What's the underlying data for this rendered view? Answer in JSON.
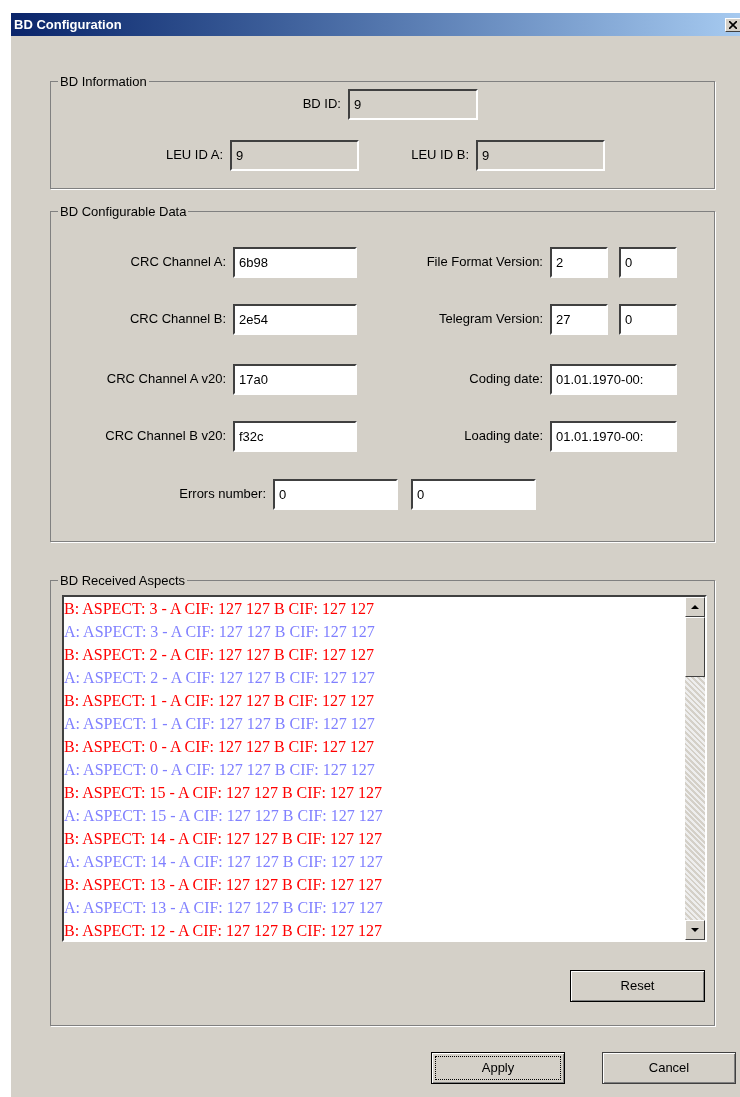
{
  "window": {
    "title": "BD Configuration"
  },
  "bd_information": {
    "title": "BD Information",
    "fields": [
      {
        "label": "BD ID:",
        "value": "9",
        "disabled": true
      },
      {
        "label": "LEU ID A:",
        "value": "9",
        "disabled": true
      },
      {
        "label": "LEU ID B:",
        "value": "9",
        "disabled": true
      }
    ]
  },
  "bd_configurable_data": {
    "title": "BD Configurable Data",
    "left_fields": [
      {
        "label": "CRC Channel A:",
        "value": "6b98",
        "disabled": false
      },
      {
        "label": "CRC Channel B:",
        "value": "2e54",
        "disabled": false
      },
      {
        "label": "CRC Channel A v20:",
        "value": "17a0",
        "disabled": false
      },
      {
        "label": "CRC Channel B v20:",
        "value": "f32c",
        "disabled": false
      }
    ],
    "right_fields": [
      {
        "label": "File Format Version:",
        "values": [
          "2",
          "0"
        ],
        "disabled": false
      },
      {
        "label": "Telegram Version:",
        "values": [
          "27",
          "0"
        ],
        "disabled": false
      },
      {
        "label": "Coding date:",
        "values": [
          "01.01.1970-00:"
        ],
        "disabled": false
      },
      {
        "label": "Loading date:",
        "values": [
          "01.01.1970-00:"
        ],
        "disabled": false
      }
    ],
    "errors": {
      "label": "Errors number:",
      "values": [
        "0",
        "0"
      ],
      "disabled": false
    }
  },
  "bd_received_aspects": {
    "title": "BD Received Aspects",
    "items": [
      {
        "text": "B: ASPECT: 3 - A CIF: 127 127 B CIF: 127 127",
        "color": "#ff0000"
      },
      {
        "text": "A: ASPECT: 3 - A CIF: 127 127 B CIF: 127 127",
        "color": "#8080ff"
      },
      {
        "text": "B: ASPECT: 2 - A CIF: 127 127 B CIF: 127 127",
        "color": "#ff0000"
      },
      {
        "text": "A: ASPECT: 2 - A CIF: 127 127 B CIF: 127 127",
        "color": "#8080ff"
      },
      {
        "text": "B: ASPECT: 1 - A CIF: 127 127 B CIF: 127 127",
        "color": "#ff0000"
      },
      {
        "text": "A: ASPECT: 1 - A CIF: 127 127 B CIF: 127 127",
        "color": "#8080ff"
      },
      {
        "text": "B: ASPECT: 0 - A CIF: 127 127 B CIF: 127 127",
        "color": "#ff0000"
      },
      {
        "text": "A: ASPECT: 0 - A CIF: 127 127 B CIF: 127 127",
        "color": "#8080ff"
      },
      {
        "text": "B: ASPECT: 15 - A CIF: 127 127 B CIF: 127 127",
        "color": "#ff0000"
      },
      {
        "text": "A: ASPECT: 15 - A CIF: 127 127 B CIF: 127 127",
        "color": "#8080ff"
      },
      {
        "text": "B: ASPECT: 14 - A CIF: 127 127 B CIF: 127 127",
        "color": "#ff0000"
      },
      {
        "text": "A: ASPECT: 14 - A CIF: 127 127 B CIF: 127 127",
        "color": "#8080ff"
      },
      {
        "text": "B: ASPECT: 13 - A CIF: 127 127 B CIF: 127 127",
        "color": "#ff0000"
      },
      {
        "text": "A: ASPECT: 13 - A CIF: 127 127 B CIF: 127 127",
        "color": "#8080ff"
      },
      {
        "text": "B: ASPECT: 12 - A CIF: 127 127 B CIF: 127 127",
        "color": "#ff0000"
      }
    ],
    "reset_button": "Reset"
  },
  "buttons": [
    {
      "label": "Apply",
      "focused": true
    },
    {
      "label": "Cancel",
      "focused": false
    }
  ]
}
